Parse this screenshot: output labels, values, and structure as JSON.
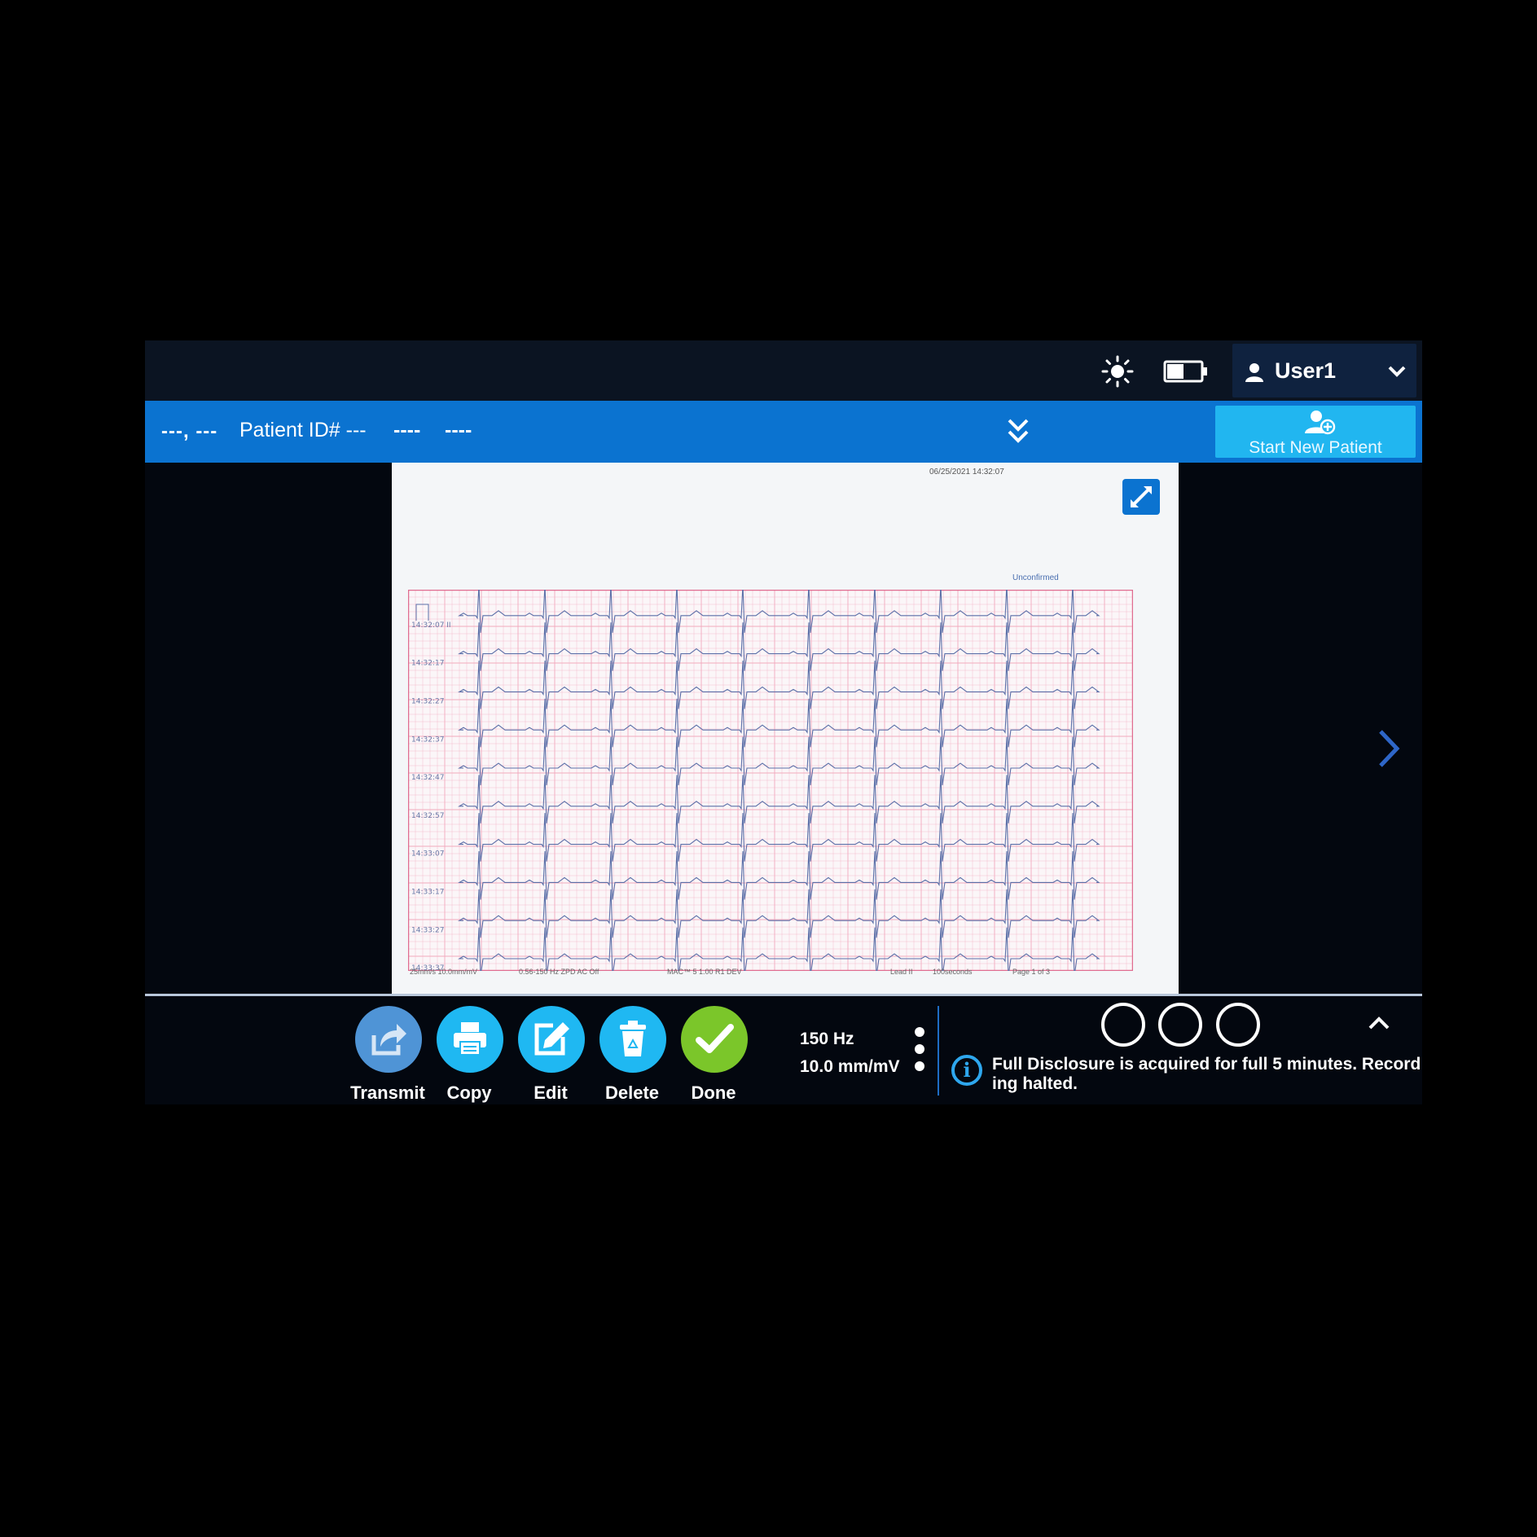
{
  "status_bar": {
    "icons": [
      "brightness-icon",
      "battery-icon"
    ],
    "user_name": "User1"
  },
  "patient_bar": {
    "patient_name": "---, ---",
    "patient_id_label": "Patient ID# ---",
    "field_1": "----",
    "field_2": "----",
    "start_new_patient": "Start New Patient"
  },
  "report": {
    "timestamp": "06/25/2021 14:32:07",
    "status": "Unconfirmed",
    "rows": [
      {
        "time": "14:32:07 II"
      },
      {
        "time": "14:32:17"
      },
      {
        "time": "14:32:27"
      },
      {
        "time": "14:32:37"
      },
      {
        "time": "14:32:47"
      },
      {
        "time": "14:32:57"
      },
      {
        "time": "14:33:07"
      },
      {
        "time": "14:33:17"
      },
      {
        "time": "14:33:27"
      },
      {
        "time": "14:33:37"
      }
    ],
    "footer": {
      "speed_gain": "25mm/s  10.0mm/mV",
      "filter": "0.56-150 Hz ZPD   AC Off",
      "device": "MAC™ 5 1.00 R1 DEV",
      "lead": "Lead II",
      "duration": "100seconds",
      "page": "Page 1 of 3"
    }
  },
  "toolbar": {
    "transmit": "Transmit",
    "copy": "Copy",
    "edit": "Edit",
    "delete": "Delete",
    "done": "Done",
    "filter": "150 Hz",
    "gain": "10.0 mm/mV",
    "info_message": "Full Disclosure is acquired for full 5 minutes. Recording halted."
  },
  "colors": {
    "status_bar": "#0b1422",
    "patient_bar": "#0b73d0",
    "start_new_button": "#21b6f0",
    "action_button": "#1fb8f2",
    "transmit_disabled": "#4f94d6",
    "done_button": "#7bc62a",
    "ecg_grid": "#f2a9bd",
    "ecg_trace": "#5b6fa8"
  }
}
